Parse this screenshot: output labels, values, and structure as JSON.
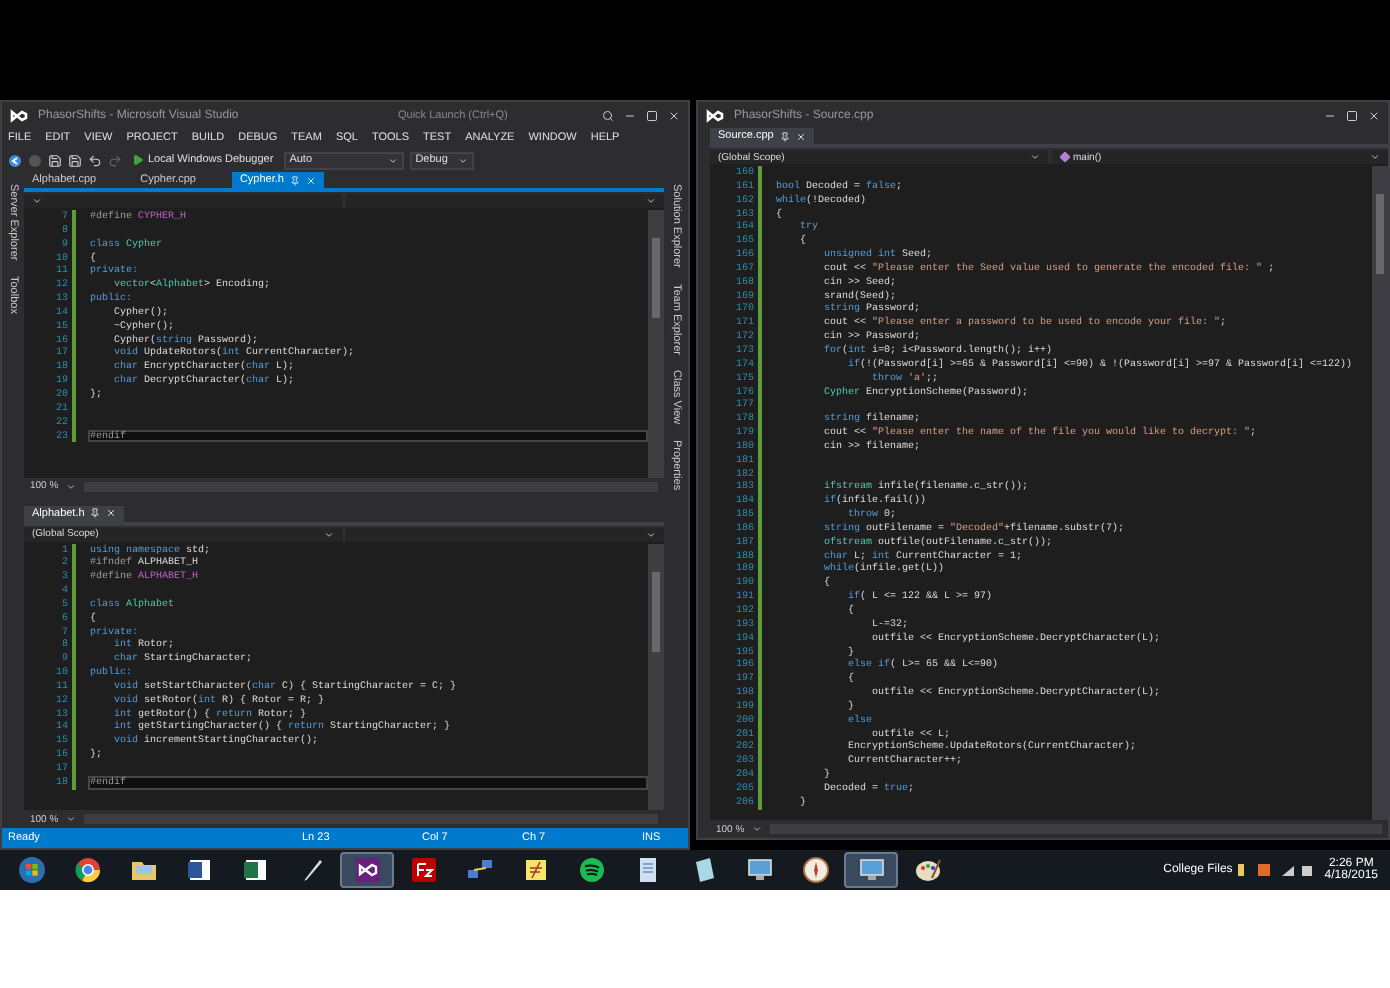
{
  "left_window": {
    "title": "PhasorShifts - Microsoft Visual Studio",
    "quick_launch": {
      "placeholder": "Quick Launch (Ctrl+Q)"
    },
    "menu": [
      "FILE",
      "EDIT",
      "VIEW",
      "PROJECT",
      "BUILD",
      "DEBUG",
      "TEAM",
      "SQL",
      "TOOLS",
      "TEST",
      "ANALYZE",
      "WINDOW",
      "HELP"
    ],
    "toolbar": {
      "debugger": "Local Windows Debugger",
      "platform": "Auto",
      "configuration": "Debug"
    },
    "side_tabs_left": [
      "Server Explorer",
      "Toolbox"
    ],
    "side_tabs_right": [
      "Solution Explorer",
      "Team Explorer",
      "Class View",
      "Properties"
    ],
    "panes": [
      {
        "focused": true,
        "tabs": [
          {
            "label": "Alphabet.cpp",
            "selected": false
          },
          {
            "label": "Cypher.cpp",
            "selected": false
          },
          {
            "label": "Cypher.h",
            "selected": true
          }
        ],
        "zoom": "100 %",
        "lines": [
          {
            "n": "7",
            "current": false,
            "tokens": [
              {
                "kind": "preproc",
                "text": "#define "
              },
              {
                "kind": "macro",
                "text": "CYPHER_H"
              }
            ]
          },
          {
            "n": "8",
            "current": false
          },
          {
            "n": "9",
            "current": false,
            "tokens": [
              {
                "kind": "keyword",
                "text": "class "
              },
              {
                "kind": "type",
                "text": "Cypher"
              }
            ]
          },
          {
            "n": "10",
            "current": false,
            "tokens": [
              {
                "kind": "plain",
                "text": "{"
              }
            ]
          },
          {
            "n": "11",
            "current": false,
            "tokens": [
              {
                "kind": "keyword",
                "text": "private:"
              }
            ]
          },
          {
            "n": "12",
            "current": false,
            "tokens": [
              {
                "kind": "type",
                "text": "    vector"
              },
              {
                "kind": "plain",
                "text": "<"
              },
              {
                "kind": "type",
                "text": "Alphabet"
              },
              {
                "kind": "plain",
                "text": "> Encoding;"
              }
            ]
          },
          {
            "n": "13",
            "current": false,
            "tokens": [
              {
                "kind": "keyword",
                "text": "public:"
              }
            ]
          },
          {
            "n": "14",
            "current": false,
            "tokens": [
              {
                "kind": "plain",
                "text": "    Cypher();"
              }
            ]
          },
          {
            "n": "15",
            "current": false,
            "tokens": [
              {
                "kind": "plain",
                "text": "    ~Cypher();"
              }
            ]
          },
          {
            "n": "16",
            "current": false,
            "tokens": [
              {
                "kind": "plain",
                "text": "    Cypher("
              },
              {
                "kind": "keyword",
                "text": "string"
              },
              {
                "kind": "plain",
                "text": " Password);"
              }
            ]
          },
          {
            "n": "17",
            "current": false,
            "tokens": [
              {
                "kind": "keyword",
                "text": "    void"
              },
              {
                "kind": "plain",
                "text": " UpdateRotors("
              },
              {
                "kind": "keyword",
                "text": "int"
              },
              {
                "kind": "plain",
                "text": " CurrentCharacter);"
              }
            ]
          },
          {
            "n": "18",
            "current": false,
            "tokens": [
              {
                "kind": "keyword",
                "text": "    char"
              },
              {
                "kind": "plain",
                "text": " EncryptCharacter("
              },
              {
                "kind": "keyword",
                "text": "char"
              },
              {
                "kind": "plain",
                "text": " L);"
              }
            ]
          },
          {
            "n": "19",
            "current": false,
            "tokens": [
              {
                "kind": "keyword",
                "text": "    char"
              },
              {
                "kind": "plain",
                "text": " DecryptCharacter("
              },
              {
                "kind": "keyword",
                "text": "char"
              },
              {
                "kind": "plain",
                "text": " L);"
              }
            ]
          },
          {
            "n": "20",
            "current": false,
            "tokens": [
              {
                "kind": "plain",
                "text": "};"
              }
            ]
          },
          {
            "n": "21",
            "current": false
          },
          {
            "n": "22",
            "current": false
          },
          {
            "n": "23",
            "current": true,
            "tokens": [
              {
                "kind": "preproc",
                "text": "#endif"
              }
            ]
          }
        ]
      },
      {
        "focused": false,
        "tabs": [
          {
            "label": "Alphabet.h",
            "selected": true
          }
        ],
        "scope": "(Global Scope)",
        "zoom": "100 %",
        "lines": [
          {
            "n": "1",
            "current": false,
            "tokens": [
              {
                "kind": "keyword",
                "text": "using namespace "
              },
              {
                "kind": "plain",
                "text": "std;"
              }
            ]
          },
          {
            "n": "2",
            "current": false,
            "tokens": [
              {
                "kind": "preproc",
                "text": "#ifndef "
              },
              {
                "kind": "plain",
                "text": "ALPHABET_H"
              }
            ]
          },
          {
            "n": "3",
            "current": false,
            "tokens": [
              {
                "kind": "preproc",
                "text": "#define "
              },
              {
                "kind": "macro",
                "text": "ALPHABET_H"
              }
            ]
          },
          {
            "n": "4",
            "current": false
          },
          {
            "n": "5",
            "current": false,
            "tokens": [
              {
                "kind": "keyword",
                "text": "class "
              },
              {
                "kind": "type",
                "text": "Alphabet"
              }
            ]
          },
          {
            "n": "6",
            "current": false,
            "tokens": [
              {
                "kind": "plain",
                "text": "{"
              }
            ]
          },
          {
            "n": "7",
            "current": false,
            "tokens": [
              {
                "kind": "keyword",
                "text": "private:"
              }
            ]
          },
          {
            "n": "8",
            "current": false,
            "tokens": [
              {
                "kind": "keyword",
                "text": "    int"
              },
              {
                "kind": "plain",
                "text": " Rotor;"
              }
            ]
          },
          {
            "n": "9",
            "current": false,
            "tokens": [
              {
                "kind": "keyword",
                "text": "    char"
              },
              {
                "kind": "plain",
                "text": " StartingCharacter;"
              }
            ]
          },
          {
            "n": "10",
            "current": false,
            "tokens": [
              {
                "kind": "keyword",
                "text": "public:"
              }
            ]
          },
          {
            "n": "11",
            "current": false,
            "tokens": [
              {
                "kind": "keyword",
                "text": "    void"
              },
              {
                "kind": "plain",
                "text": " setStartCharacter("
              },
              {
                "kind": "keyword",
                "text": "char"
              },
              {
                "kind": "plain",
                "text": " C) { StartingCharacter = C; }"
              }
            ]
          },
          {
            "n": "12",
            "current": false,
            "tokens": [
              {
                "kind": "keyword",
                "text": "    void"
              },
              {
                "kind": "plain",
                "text": " setRotor("
              },
              {
                "kind": "keyword",
                "text": "int"
              },
              {
                "kind": "plain",
                "text": " R) { Rotor = R; }"
              }
            ]
          },
          {
            "n": "13",
            "current": false,
            "tokens": [
              {
                "kind": "keyword",
                "text": "    int"
              },
              {
                "kind": "plain",
                "text": " getRotor() { "
              },
              {
                "kind": "keyword",
                "text": "return"
              },
              {
                "kind": "plain",
                "text": " Rotor; }"
              }
            ]
          },
          {
            "n": "14",
            "current": false,
            "tokens": [
              {
                "kind": "keyword",
                "text": "    int"
              },
              {
                "kind": "plain",
                "text": " getStartingCharacter() { "
              },
              {
                "kind": "keyword",
                "text": "return"
              },
              {
                "kind": "plain",
                "text": " StartingCharacter; }"
              }
            ]
          },
          {
            "n": "15",
            "current": false,
            "tokens": [
              {
                "kind": "keyword",
                "text": "    void"
              },
              {
                "kind": "plain",
                "text": " incrementStartingCharacter();"
              }
            ]
          },
          {
            "n": "16",
            "current": false,
            "tokens": [
              {
                "kind": "plain",
                "text": "};"
              }
            ]
          },
          {
            "n": "17",
            "current": false
          },
          {
            "n": "18",
            "current": true,
            "tokens": [
              {
                "kind": "preproc",
                "text": "#endif"
              }
            ]
          }
        ]
      }
    ],
    "status_bar": [
      "Ready",
      "Ln 23",
      "Col 7",
      "Ch 7",
      "INS"
    ]
  },
  "right_window": {
    "title": "PhasorShifts - Source.cpp",
    "pane": {
      "focused": false,
      "tabs": [
        {
          "label": "Source.cpp",
          "selected": true
        }
      ],
      "scope": "(Global Scope)",
      "member": "main()",
      "zoom": "100 %",
      "lines": [
        {
          "n": "160",
          "current": false
        },
        {
          "n": "161",
          "current": false,
          "tokens": [
            {
              "kind": "keyword",
              "text": "bool"
            },
            {
              "kind": "plain",
              "text": " Decoded = "
            },
            {
              "kind": "keyword",
              "text": "false"
            },
            {
              "kind": "plain",
              "text": ";"
            }
          ]
        },
        {
          "n": "162",
          "current": false,
          "tokens": [
            {
              "kind": "keyword",
              "text": "while"
            },
            {
              "kind": "plain",
              "text": "(!Decoded)"
            }
          ]
        },
        {
          "n": "163",
          "current": false,
          "tokens": [
            {
              "kind": "plain",
              "text": "{"
            }
          ]
        },
        {
          "n": "164",
          "current": false,
          "tokens": [
            {
              "kind": "keyword",
              "text": "    try"
            }
          ]
        },
        {
          "n": "165",
          "current": false,
          "tokens": [
            {
              "kind": "plain",
              "text": "    {"
            }
          ]
        },
        {
          "n": "166",
          "current": false,
          "tokens": [
            {
              "kind": "keyword",
              "text": "        unsigned int"
            },
            {
              "kind": "plain",
              "text": " Seed;"
            }
          ]
        },
        {
          "n": "167",
          "current": false,
          "tokens": [
            {
              "kind": "plain",
              "text": "        cout << "
            },
            {
              "kind": "string",
              "text": "\"Please enter the Seed value used to generate the encoded file: \""
            },
            {
              "kind": "plain",
              "text": " ;"
            }
          ]
        },
        {
          "n": "168",
          "current": false,
          "tokens": [
            {
              "kind": "plain",
              "text": "        cin >> Seed;"
            }
          ]
        },
        {
          "n": "169",
          "current": false,
          "tokens": [
            {
              "kind": "plain",
              "text": "        srand(Seed);"
            }
          ]
        },
        {
          "n": "170",
          "current": false,
          "tokens": [
            {
              "kind": "keyword",
              "text": "        string"
            },
            {
              "kind": "plain",
              "text": " Password;"
            }
          ]
        },
        {
          "n": "171",
          "current": false,
          "tokens": [
            {
              "kind": "plain",
              "text": "        cout << "
            },
            {
              "kind": "string",
              "text": "\"Please enter a password to be used to encode your file: \""
            },
            {
              "kind": "plain",
              "text": ";"
            }
          ]
        },
        {
          "n": "172",
          "current": false,
          "tokens": [
            {
              "kind": "plain",
              "text": "        cin >> Password;"
            }
          ]
        },
        {
          "n": "173",
          "current": false,
          "tokens": [
            {
              "kind": "keyword",
              "text": "        for"
            },
            {
              "kind": "plain",
              "text": "("
            },
            {
              "kind": "keyword",
              "text": "int"
            },
            {
              "kind": "plain",
              "text": " i=0; i<Password.length(); i++)"
            }
          ]
        },
        {
          "n": "174",
          "current": false,
          "tokens": [
            {
              "kind": "keyword",
              "text": "            if"
            },
            {
              "kind": "plain",
              "text": "(!(Password[i] >=65 & Password[i] <=90) & !(Password[i] >=97 & Password[i] <=122))"
            }
          ]
        },
        {
          "n": "175",
          "current": false,
          "tokens": [
            {
              "kind": "keyword",
              "text": "                throw"
            },
            {
              "kind": "string",
              "text": " 'a'"
            },
            {
              "kind": "plain",
              "text": ";;"
            }
          ]
        },
        {
          "n": "176",
          "current": false,
          "tokens": [
            {
              "kind": "type",
              "text": "        Cypher"
            },
            {
              "kind": "plain",
              "text": " EncryptionScheme(Password);"
            }
          ]
        },
        {
          "n": "177",
          "current": false
        },
        {
          "n": "178",
          "current": false,
          "tokens": [
            {
              "kind": "keyword",
              "text": "        string"
            },
            {
              "kind": "plain",
              "text": " filename;"
            }
          ]
        },
        {
          "n": "179",
          "current": false,
          "tokens": [
            {
              "kind": "plain",
              "text": "        cout << "
            },
            {
              "kind": "string",
              "text": "\"Please enter the name of the file you would like to decrypt: \""
            },
            {
              "kind": "plain",
              "text": ";"
            }
          ]
        },
        {
          "n": "180",
          "current": false,
          "tokens": [
            {
              "kind": "plain",
              "text": "        cin >> filename;"
            }
          ]
        },
        {
          "n": "181",
          "current": false
        },
        {
          "n": "182",
          "current": false
        },
        {
          "n": "183",
          "current": false,
          "tokens": [
            {
              "kind": "type",
              "text": "        ifstream"
            },
            {
              "kind": "plain",
              "text": " infile(filename.c_str());"
            }
          ]
        },
        {
          "n": "184",
          "current": false,
          "tokens": [
            {
              "kind": "keyword",
              "text": "        if"
            },
            {
              "kind": "plain",
              "text": "(infile.fail())"
            }
          ]
        },
        {
          "n": "185",
          "current": false,
          "tokens": [
            {
              "kind": "keyword",
              "text": "            throw"
            },
            {
              "kind": "plain",
              "text": " 0;"
            }
          ]
        },
        {
          "n": "186",
          "current": false,
          "tokens": [
            {
              "kind": "keyword",
              "text": "        string"
            },
            {
              "kind": "plain",
              "text": " outFilename = "
            },
            {
              "kind": "string",
              "text": "\"Decoded\""
            },
            {
              "kind": "plain",
              "text": "+filename.substr(7);"
            }
          ]
        },
        {
          "n": "187",
          "current": false,
          "tokens": [
            {
              "kind": "type",
              "text": "        ofstream"
            },
            {
              "kind": "plain",
              "text": " outfile(outFilename.c_str());"
            }
          ]
        },
        {
          "n": "188",
          "current": false,
          "tokens": [
            {
              "kind": "keyword",
              "text": "        char"
            },
            {
              "kind": "plain",
              "text": " L; "
            },
            {
              "kind": "keyword",
              "text": "int"
            },
            {
              "kind": "plain",
              "text": " CurrentCharacter = 1;"
            }
          ]
        },
        {
          "n": "189",
          "current": false,
          "tokens": [
            {
              "kind": "keyword",
              "text": "        while"
            },
            {
              "kind": "plain",
              "text": "(infile.get(L))"
            }
          ]
        },
        {
          "n": "190",
          "current": false,
          "tokens": [
            {
              "kind": "plain",
              "text": "        {"
            }
          ]
        },
        {
          "n": "191",
          "current": false,
          "tokens": [
            {
              "kind": "keyword",
              "text": "            if"
            },
            {
              "kind": "plain",
              "text": "( L <= 122 && L >= 97)"
            }
          ]
        },
        {
          "n": "192",
          "current": false,
          "tokens": [
            {
              "kind": "plain",
              "text": "            {"
            }
          ]
        },
        {
          "n": "193",
          "current": false,
          "tokens": [
            {
              "kind": "plain",
              "text": "                L-=32;"
            }
          ]
        },
        {
          "n": "194",
          "current": false,
          "tokens": [
            {
              "kind": "plain",
              "text": "                outfile << EncryptionScheme.DecryptCharacter(L);"
            }
          ]
        },
        {
          "n": "195",
          "current": false,
          "tokens": [
            {
              "kind": "plain",
              "text": "            }"
            }
          ]
        },
        {
          "n": "196",
          "current": false,
          "tokens": [
            {
              "kind": "keyword",
              "text": "            else if"
            },
            {
              "kind": "plain",
              "text": "( L>= 65 && L<=90)"
            }
          ]
        },
        {
          "n": "197",
          "current": false,
          "tokens": [
            {
              "kind": "plain",
              "text": "            {"
            }
          ]
        },
        {
          "n": "198",
          "current": false,
          "tokens": [
            {
              "kind": "plain",
              "text": "                outfile << EncryptionScheme.DecryptCharacter(L);"
            }
          ]
        },
        {
          "n": "199",
          "current": false,
          "tokens": [
            {
              "kind": "plain",
              "text": "            }"
            }
          ]
        },
        {
          "n": "200",
          "current": false,
          "tokens": [
            {
              "kind": "keyword",
              "text": "            else"
            }
          ]
        },
        {
          "n": "201",
          "current": false,
          "tokens": [
            {
              "kind": "plain",
              "text": "                outfile << L;"
            }
          ]
        },
        {
          "n": "202",
          "current": false,
          "tokens": [
            {
              "kind": "plain",
              "text": "            EncryptionScheme.UpdateRotors(CurrentCharacter);"
            }
          ]
        },
        {
          "n": "203",
          "current": false,
          "tokens": [
            {
              "kind": "plain",
              "text": "            CurrentCharacter++;"
            }
          ]
        },
        {
          "n": "204",
          "current": false,
          "tokens": [
            {
              "kind": "plain",
              "text": "        }"
            }
          ]
        },
        {
          "n": "205",
          "current": false,
          "tokens": [
            {
              "kind": "plain",
              "text": "        Decoded = "
            },
            {
              "kind": "keyword",
              "text": "true"
            },
            {
              "kind": "plain",
              "text": ";"
            }
          ]
        },
        {
          "n": "206",
          "current": false,
          "tokens": [
            {
              "kind": "plain",
              "text": "    }"
            }
          ]
        }
      ]
    }
  },
  "taskbar": {
    "items": [
      {
        "kind": "start",
        "selected": false
      },
      {
        "kind": "browser",
        "selected": false
      },
      {
        "kind": "folder",
        "selected": false
      },
      {
        "kind": "document",
        "selected": false
      },
      {
        "kind": "spreadsheet",
        "selected": false
      },
      {
        "kind": "pen",
        "selected": false
      },
      {
        "kind": "infinity",
        "selected": true
      },
      {
        "kind": "tile",
        "selected": false
      },
      {
        "kind": "network",
        "selected": false
      },
      {
        "kind": "note",
        "selected": false
      },
      {
        "kind": "waves",
        "selected": false
      },
      {
        "kind": "page",
        "selected": false
      },
      {
        "kind": "notepad",
        "selected": false
      },
      {
        "kind": "monitor",
        "selected": false
      },
      {
        "kind": "compass",
        "selected": false
      },
      {
        "kind": "monitor",
        "selected": true
      },
      {
        "kind": "palette",
        "selected": false
      }
    ],
    "toolbar_label": "College Files",
    "time": "2:26 PM",
    "date": "4/18/2015"
  }
}
